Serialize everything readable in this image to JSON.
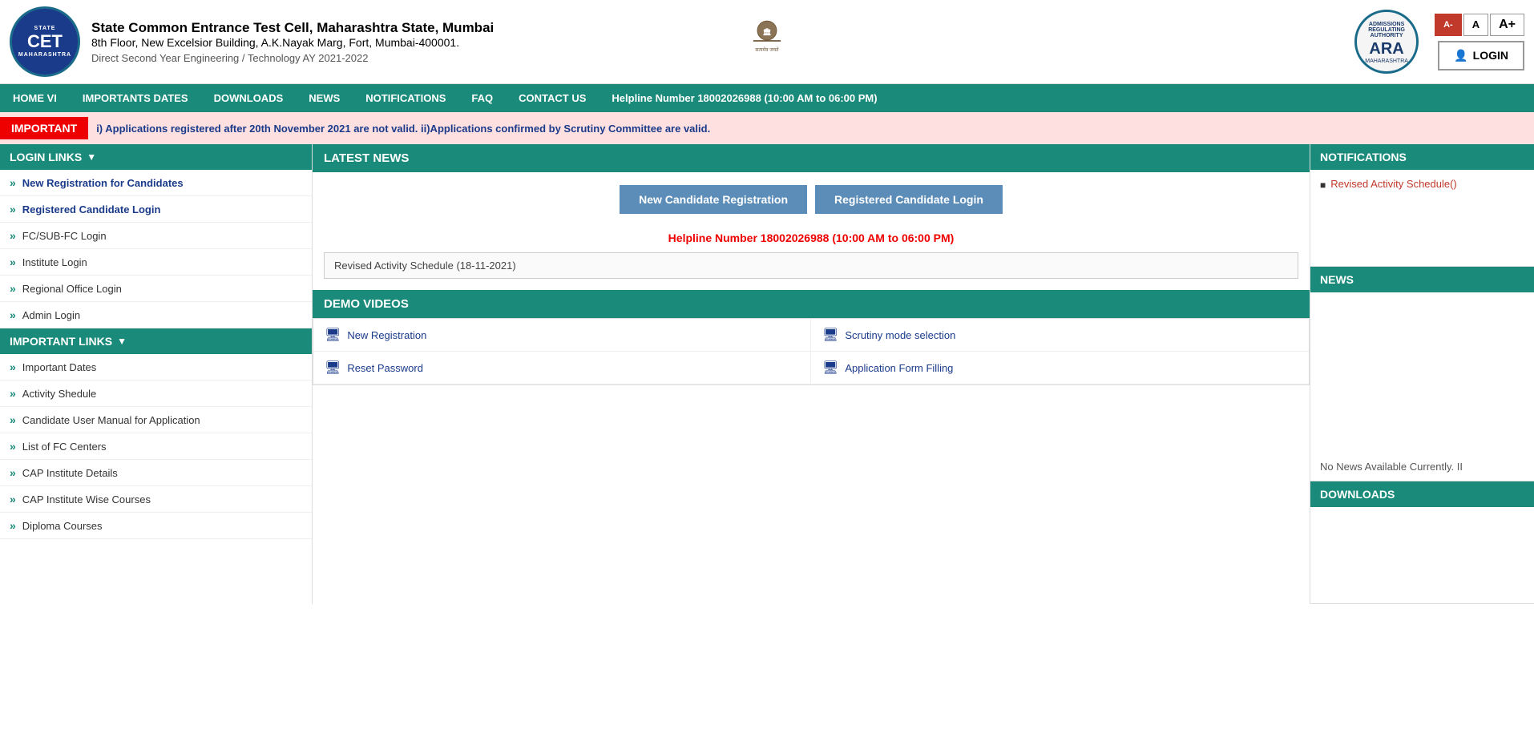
{
  "header": {
    "org_name": "State Common Entrance Test Cell, Maharashtra State, Mumbai",
    "address": "8th Floor, New Excelsior Building, A.K.Nayak Marg, Fort, Mumbai-400001.",
    "subtitle": "Direct Second Year Engineering / Technology AY 2021-2022",
    "font_minus": "A-",
    "font_normal": "A",
    "font_plus": "A+",
    "login_label": "LOGIN"
  },
  "navbar": {
    "items": [
      {
        "label": "HOME VI"
      },
      {
        "label": "IMPORTANTS DATES"
      },
      {
        "label": "DOWNLOADS"
      },
      {
        "label": "NEWS"
      },
      {
        "label": "NOTIFICATIONS"
      },
      {
        "label": "FAQ"
      },
      {
        "label": "CONTACT US"
      }
    ],
    "helpline": "Helpline Number 18002026988 (10:00 AM to 06:00 PM)"
  },
  "important_banner": {
    "label": "IMPORTANT",
    "text": "i) Applications registered after 20th November 2021 are not valid.   ii)Applications confirmed by Scrutiny Committee are valid."
  },
  "sidebar": {
    "login_links_header": "LOGIN LINKS",
    "login_items": [
      {
        "label": "New Registration for Candidates",
        "highlighted": true
      },
      {
        "label": "Registered Candidate Login",
        "highlighted": true
      },
      {
        "label": "FC/SUB-FC Login",
        "highlighted": false
      },
      {
        "label": "Institute Login",
        "highlighted": false
      },
      {
        "label": "Regional Office Login",
        "highlighted": false
      },
      {
        "label": "Admin Login",
        "highlighted": false
      }
    ],
    "important_links_header": "IMPORTANT LINKS",
    "important_items": [
      {
        "label": "Important Dates"
      },
      {
        "label": "Activity Shedule"
      },
      {
        "label": "Candidate User Manual for Application"
      },
      {
        "label": "List of FC Centers"
      },
      {
        "label": "CAP Institute Details"
      },
      {
        "label": "CAP Institute Wise Courses"
      },
      {
        "label": "Diploma Courses"
      }
    ]
  },
  "latest_news": {
    "section_title": "LATEST NEWS",
    "btn_registration": "New Candidate Registration",
    "btn_login": "Registered Candidate Login",
    "helpline": "Helpline Number 18002026988 (10:00 AM to 06:00 PM)",
    "news_item": "Revised Activity Schedule (18-11-2021)"
  },
  "demo_videos": {
    "section_title": "DEMO VIDEOS",
    "items": [
      {
        "label": "New Registration"
      },
      {
        "label": "Scrutiny mode selection"
      },
      {
        "label": "Reset Password"
      },
      {
        "label": "Application Form Filling"
      }
    ]
  },
  "notifications": {
    "section_title": "NOTIFICATIONS",
    "items": [
      {
        "label": "Revised Activity Schedule()"
      }
    ]
  },
  "news_panel": {
    "section_title": "NEWS",
    "items": [
      {
        "label": "No News Available Currently. II"
      }
    ]
  },
  "downloads": {
    "section_title": "DOWNLOADS"
  }
}
